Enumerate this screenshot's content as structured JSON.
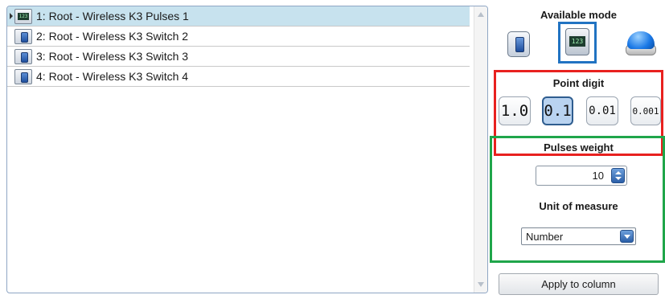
{
  "list": {
    "rows": [
      {
        "label": "1: Root - Wireless K3 Pulses 1",
        "icon": "counter-icon",
        "selected": true
      },
      {
        "label": "2: Root - Wireless K3 Switch 2",
        "icon": "switch-icon",
        "selected": false
      },
      {
        "label": "3: Root - Wireless K3 Switch 3",
        "icon": "switch-icon",
        "selected": false
      },
      {
        "label": "4: Root - Wireless K3 Switch 4",
        "icon": "switch-icon",
        "selected": false
      }
    ]
  },
  "panel": {
    "available_mode_title": "Available mode",
    "modes": [
      {
        "icon": "switch-mode-icon",
        "selected": false
      },
      {
        "icon": "counter-mode-icon",
        "selected": true
      },
      {
        "icon": "push-button-mode-icon",
        "selected": false
      }
    ],
    "point_digit_title": "Point digit",
    "point_digits": [
      "1.0",
      "0.1",
      "0.01",
      "0.001"
    ],
    "point_digit_selected": "0.1",
    "pulses_weight_title": "Pulses weight",
    "pulses_weight_value": "10",
    "unit_of_measure_title": "Unit of measure",
    "unit_of_measure_value": "Number",
    "apply_label": "Apply to column"
  },
  "colors": {
    "selected_row": "#c7e2ee",
    "mode_highlight": "#2173c2",
    "point_digit_frame": "#e8211f",
    "pulses_frame": "#1fa64a"
  }
}
